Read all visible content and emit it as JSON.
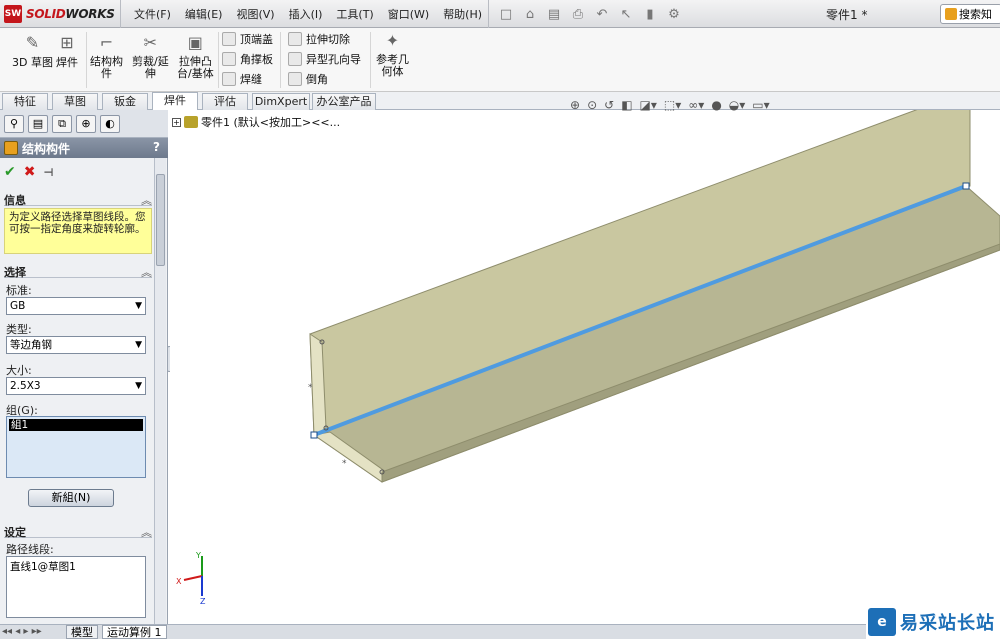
{
  "app": {
    "brand_prefix": "SOLID",
    "brand_suffix": "WORKS",
    "doc_title": "零件1 *"
  },
  "menu": [
    "文件(F)",
    "编辑(E)",
    "视图(V)",
    "插入(I)",
    "工具(T)",
    "窗口(W)",
    "帮助(H)"
  ],
  "search": {
    "label": "搜索知"
  },
  "ribbon": {
    "sketch3d": "3D 草图",
    "weldment": "焊件",
    "structural_member": [
      "结构构",
      "件"
    ],
    "trim_extend": [
      "剪裁/延",
      "伸"
    ],
    "extrude_boss": [
      "拉伸凸",
      "台/基体"
    ],
    "end_cap": "顶端盖",
    "gusset": "角撑板",
    "weld_bead": "焊缝",
    "extrude_cut": "拉伸切除",
    "hole_wizard": "异型孔向导",
    "chamfer": "倒角",
    "ref_geometry": [
      "参考几",
      "何体"
    ]
  },
  "tabs": [
    "特征",
    "草图",
    "钣金",
    "焊件",
    "评估",
    "DimXpert",
    "办公室产品"
  ],
  "active_tab": "焊件",
  "panel": {
    "title": "结构构件",
    "help": "?",
    "info_title": "信息",
    "info_text": "为定义路径选择草图线段。您可按一指定角度来旋转轮廓。",
    "select_title": "选择",
    "standard_label": "标准:",
    "standard_value": "GB",
    "type_label": "类型:",
    "type_value": "等边角钢",
    "size_label": "大小:",
    "size_value": "2.5X3",
    "group_label": "组(G):",
    "group_item": "組1",
    "new_group": "新組(N)",
    "settings_title": "设定",
    "path_label": "路径线段:",
    "path_value": "直线1@草图1"
  },
  "tree": {
    "label": "零件1 (默认<按加工><<..."
  },
  "triad": {
    "x": "X",
    "y": "Y",
    "z": "Z"
  },
  "bottom_tabs": [
    "模型",
    "运动算例 1"
  ],
  "watermark": {
    "text": "易采站长站"
  },
  "colors": {
    "accent": "#c4161c",
    "beam": "#c9c7a0",
    "path": "#4f9be0"
  }
}
